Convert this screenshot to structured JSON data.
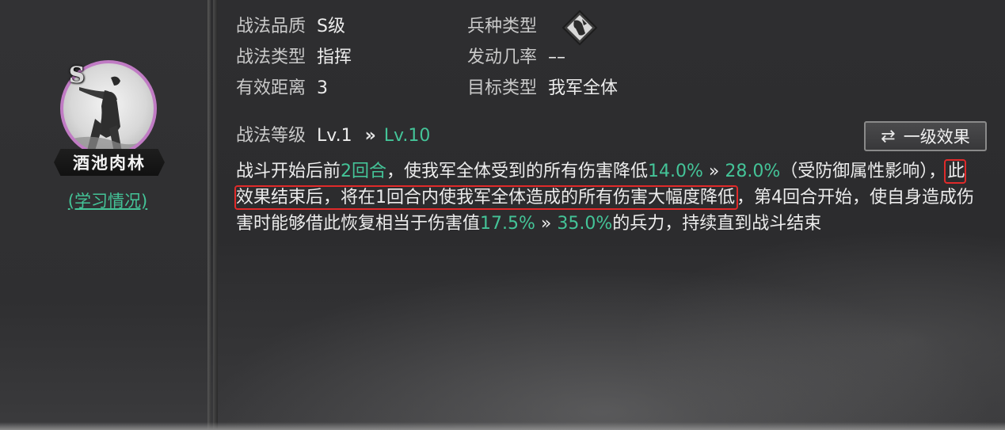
{
  "hero": {
    "grade": "S",
    "name": "酒池肉林",
    "study_link": "(学习情况)"
  },
  "info": {
    "quality_label": "战法品质",
    "quality_value": "S级",
    "troop_label": "兵种类型",
    "type_label": "战法类型",
    "type_value": "指挥",
    "rate_label": "发动几率",
    "rate_value": "––",
    "range_label": "有效距离",
    "range_value": "3",
    "target_label": "目标类型",
    "target_value": "我军全体"
  },
  "level": {
    "label": "战法等级",
    "current": "Lv.1",
    "arrow": "»",
    "max": "Lv.10"
  },
  "effect_button": {
    "icon": "swap-arrows-icon",
    "label": "一级效果"
  },
  "description": {
    "p1": "战斗开始后前",
    "turns": "2回合",
    "p2": "，使我军全体受到的所有伤害降低",
    "v1": "14.0%",
    "arrow1": " » ",
    "v2": "28.0%",
    "p3": "（受防御属性影响），",
    "highlight": "此效果结束后，将在1回合内使我军全体造成的所有伤害大幅度降低",
    "p4": "，第4回合开始，使自身造成伤害时能够借此恢复相当于伤害值",
    "v3": "17.5%",
    "arrow2": " » ",
    "v4": "35.0%",
    "p5": "的兵力，持续直到战斗结束"
  },
  "colors": {
    "accent_green": "#44c498",
    "avatar_ring": "#c07bc4",
    "highlight_box": "#e02a2a"
  }
}
